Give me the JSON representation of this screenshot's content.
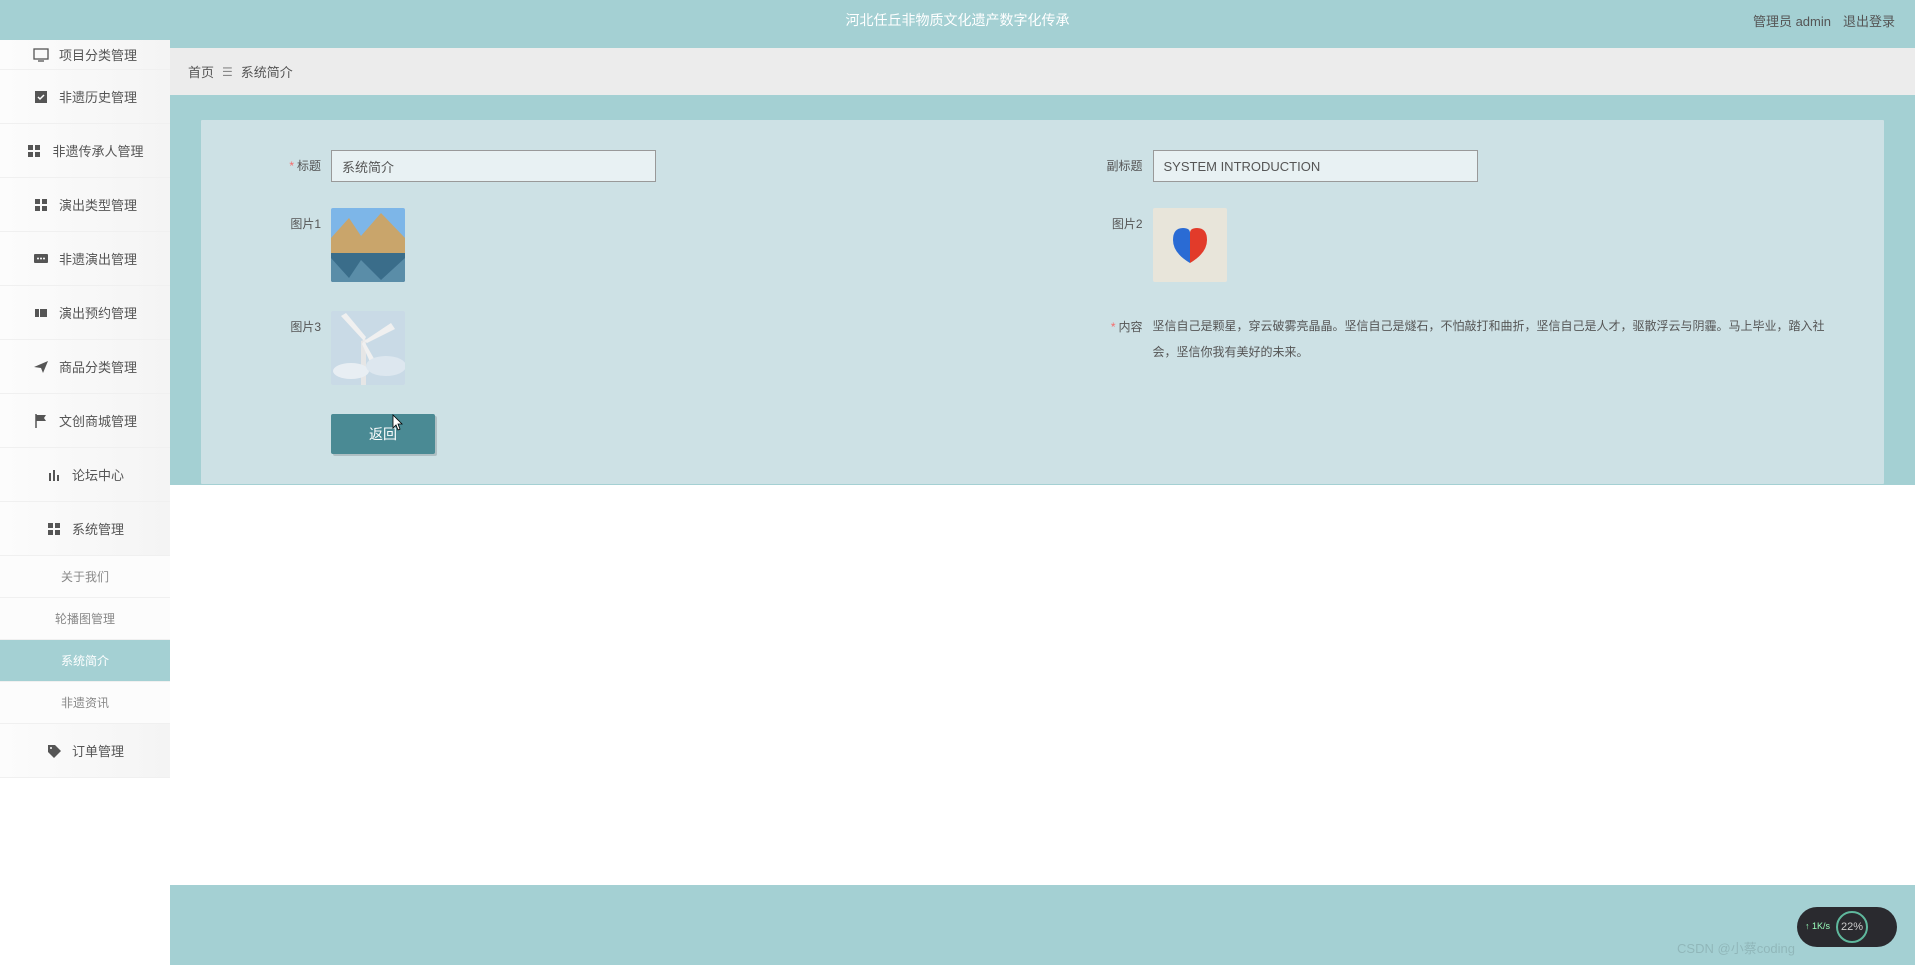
{
  "header": {
    "title": "河北任丘非物质文化遗产数字化传承",
    "user_label": "管理员 admin",
    "logout": "退出登录"
  },
  "breadcrumb": {
    "home": "首页",
    "current": "系统简介"
  },
  "sidebar": {
    "items": [
      {
        "label": "项目分类管理",
        "icon": "monitor"
      },
      {
        "label": "非遗历史管理",
        "icon": "check"
      },
      {
        "label": "非遗传承人管理",
        "icon": "grid"
      },
      {
        "label": "演出类型管理",
        "icon": "grid"
      },
      {
        "label": "非遗演出管理",
        "icon": "chat"
      },
      {
        "label": "演出预约管理",
        "icon": "ticket"
      },
      {
        "label": "商品分类管理",
        "icon": "send"
      },
      {
        "label": "文创商城管理",
        "icon": "flag"
      },
      {
        "label": "论坛中心",
        "icon": "bars"
      },
      {
        "label": "系统管理",
        "icon": "grid"
      }
    ],
    "subs": [
      {
        "label": "关于我们",
        "active": false
      },
      {
        "label": "轮播图管理",
        "active": false
      },
      {
        "label": "系统简介",
        "active": true
      },
      {
        "label": "非遗资讯",
        "active": false
      }
    ],
    "items_tail": [
      {
        "label": "订单管理",
        "icon": "tag"
      }
    ]
  },
  "form": {
    "title_label": "标题",
    "title_value": "系统简介",
    "subtitle_label": "副标题",
    "subtitle_value": "SYSTEM INTRODUCTION",
    "img1_label": "图片1",
    "img2_label": "图片2",
    "img3_label": "图片3",
    "content_label": "内容",
    "content_value": "坚信自己是颗星，穿云破雾亮晶晶。坚信自己是燧石，不怕敲打和曲折，坚信自己是人才，驱散浮云与阴霾。马上毕业，踏入社会，坚信你我有美好的未来。",
    "back_btn": "返回"
  },
  "netmon": {
    "up": "1K/s",
    "usage": "22%"
  },
  "watermark": "CSDN @小蔡coding"
}
